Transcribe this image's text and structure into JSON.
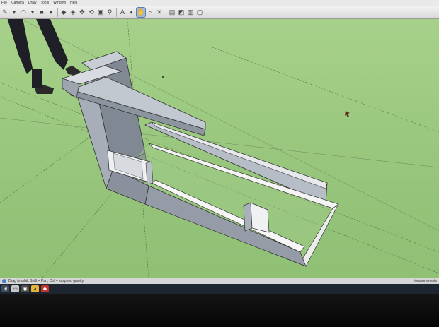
{
  "menubar": {
    "items": [
      "File",
      "Camera",
      "Draw",
      "Tools",
      "Window",
      "Help"
    ]
  },
  "toolbar": {
    "tools": [
      {
        "icon": "pencil-icon",
        "glyph": "✎"
      },
      {
        "icon": "dropdown-icon",
        "glyph": "▾"
      },
      {
        "icon": "arc-icon",
        "glyph": "◠"
      },
      {
        "icon": "dropdown-icon",
        "glyph": "▾"
      },
      {
        "icon": "rectangle-icon",
        "glyph": "■"
      },
      {
        "icon": "dropdown-icon",
        "glyph": "▾"
      },
      {
        "icon": "push-pull-icon",
        "glyph": "◆"
      },
      {
        "icon": "offset-icon",
        "glyph": "◈"
      },
      {
        "icon": "move-icon",
        "glyph": "✥"
      },
      {
        "icon": "rotate-icon",
        "glyph": "⟲"
      },
      {
        "icon": "scale-icon",
        "glyph": "▣"
      },
      {
        "icon": "tape-measure-icon",
        "glyph": "⚲"
      },
      {
        "icon": "text-icon",
        "glyph": "A"
      },
      {
        "icon": "paint-bucket-icon",
        "glyph": "◐"
      },
      {
        "icon": "orbit-icon",
        "glyph": "✋"
      },
      {
        "icon": "zoom-icon",
        "glyph": "⌕"
      },
      {
        "icon": "zoom-extents-icon",
        "glyph": "✕"
      },
      {
        "icon": "warehouse-icon",
        "glyph": "▤"
      },
      {
        "icon": "components-icon",
        "glyph": "◩"
      },
      {
        "icon": "extension-icon",
        "glyph": "▥"
      },
      {
        "icon": "layout-icon",
        "glyph": "▢"
      }
    ],
    "active_tool": "orbit-icon"
  },
  "status": {
    "hint": "Drag to orbit. Shift = Pan, Ctrl = suspend gravity.",
    "measurements_label": "Measurements"
  },
  "taskbar": {
    "apps": [
      "start-icon",
      "file-explorer-icon",
      "camera-app-icon",
      "chrome-icon",
      "sketchup-icon"
    ]
  },
  "colors": {
    "ground": "#9bc981",
    "model_face": "#a9b0bb",
    "model_inner": "#f2f2f2",
    "toolbar": "#e4e4e4"
  }
}
